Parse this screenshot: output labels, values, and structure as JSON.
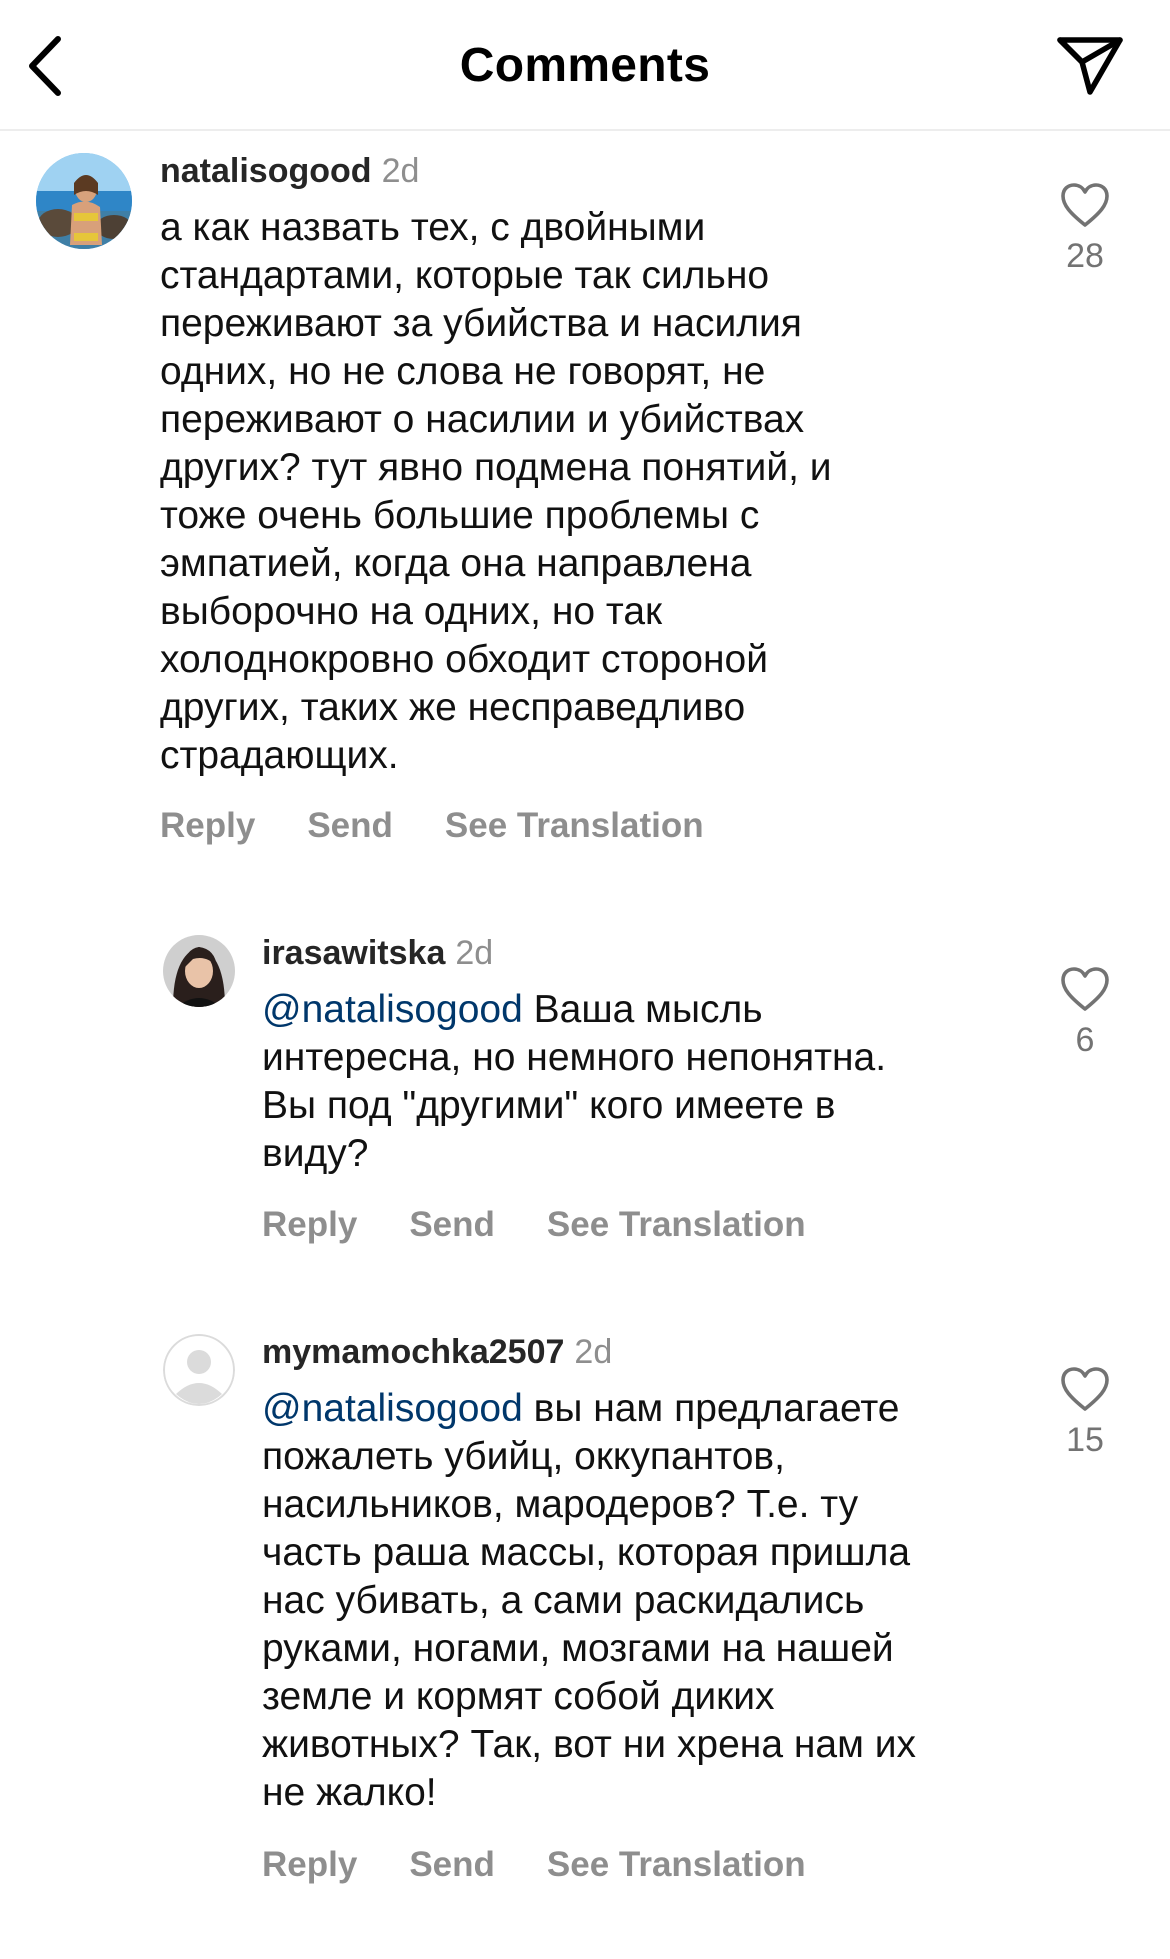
{
  "header": {
    "title": "Comments",
    "back_icon": "chevron-left-icon",
    "share_icon": "paper-plane-icon"
  },
  "comments": [
    {
      "username": "natalisogood",
      "time": "2d",
      "avatar": "beach-photo-avatar",
      "mention": "",
      "lines": [
        "а как назвать тех, с двойными",
        "стандартами, которые так сильно",
        "переживают за убийства и насилия",
        "одних, но не слова не говорят, не",
        "переживают о насилии и убийствах",
        "других? тут явно подмена понятий, и",
        "тоже очень большие проблемы с",
        "эмпатией, когда она направлена",
        "выборочно на одних, но так",
        "холоднокровно обходит стороной",
        "других, таких же несправедливо",
        "страдающих."
      ],
      "likes": "28",
      "actions": {
        "reply": "Reply",
        "send": "Send",
        "translate": "See Translation"
      }
    },
    {
      "username": "irasawitska",
      "time": "2d",
      "avatar": "portrait-photo-avatar",
      "mention": "@natalisogood",
      "lines": [
        " Ваша мысль",
        "интересна, но немного непонятна.",
        "Вы под \"другими\" кого имеете в",
        "виду?"
      ],
      "likes": "6",
      "actions": {
        "reply": "Reply",
        "send": "Send",
        "translate": "See Translation"
      }
    },
    {
      "username": "mymamochka2507",
      "time": "2d",
      "avatar": "default-user-avatar",
      "mention": "@natalisogood",
      "lines": [
        " вы нам предлагаете",
        "пожалеть убийц, оккупантов,",
        "насильников, мародеров? Т.е. ту",
        "часть раша массы, которая пришла",
        "нас убивать, а сами раскидались",
        "руками, ногами, мозгами на нашей",
        "земле и кормят собой диких",
        "животных? Так, вот ни хрена нам их",
        "не жалко!"
      ],
      "likes": "15",
      "actions": {
        "reply": "Reply",
        "send": "Send",
        "translate": "See Translation"
      }
    }
  ],
  "colors": {
    "mention": "#00376b",
    "secondary": "#8e8e8e",
    "divider": "#ededed"
  }
}
